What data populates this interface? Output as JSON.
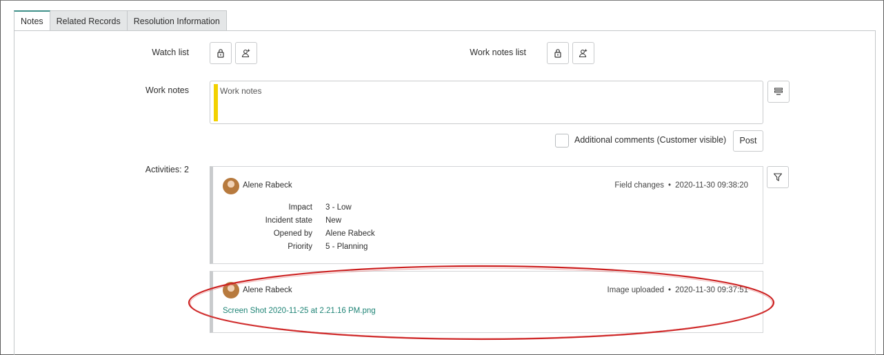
{
  "tabs": [
    {
      "label": "Notes",
      "active": true
    },
    {
      "label": "Related Records",
      "active": false
    },
    {
      "label": "Resolution Information",
      "active": false
    }
  ],
  "watch_list": {
    "label": "Watch list",
    "icons": [
      "lock-icon",
      "add-user-icon"
    ]
  },
  "work_notes_list": {
    "label": "Work notes list",
    "icons": [
      "lock-icon",
      "add-user-icon"
    ]
  },
  "work_notes": {
    "label": "Work notes",
    "placeholder": "Work notes",
    "side_button_icon": "list-toggle-icon"
  },
  "additional_comments": {
    "label": "Additional comments (Customer visible)",
    "checked": false
  },
  "post_button": "Post",
  "activities": {
    "label": "Activities: 2",
    "filter_icon": "filter-icon",
    "entries": [
      {
        "author": "Alene Rabeck",
        "type": "Field changes",
        "timestamp": "2020-11-30 09:38:20",
        "fields": [
          {
            "name": "Impact",
            "value": "3 - Low"
          },
          {
            "name": "Incident state",
            "value": "New"
          },
          {
            "name": "Opened by",
            "value": "Alene Rabeck"
          },
          {
            "name": "Priority",
            "value": "5 - Planning"
          }
        ]
      },
      {
        "author": "Alene Rabeck",
        "type": "Image uploaded",
        "timestamp": "2020-11-30 09:37:51",
        "attachment": "Screen Shot 2020-11-25 at 2.21.16 PM.png"
      }
    ]
  },
  "colors": {
    "accent": "#3d8f88",
    "work_note_flag": "#f2d100",
    "link": "#1f8476",
    "annotation": "#cc1f1f"
  }
}
